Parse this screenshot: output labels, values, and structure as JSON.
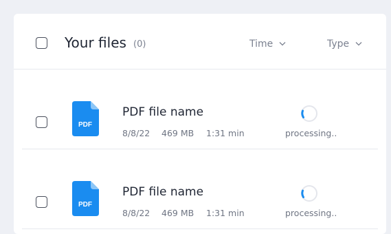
{
  "header": {
    "title": "Your files",
    "count": "(0)",
    "sort_time": "Time",
    "sort_type": "Type",
    "chevron": "⌄"
  },
  "files": [
    {
      "icon": "pdf-icon",
      "icon_label": "PDF",
      "name": "PDF file name",
      "date": "8/8/22",
      "size": "469 MB",
      "duration": "1:31 min",
      "status": "processing.."
    },
    {
      "icon": "pdf-icon",
      "icon_label": "PDF",
      "name": "PDF file name",
      "date": "8/8/22",
      "size": "469 MB",
      "duration": "1:31 min",
      "status": "processing.."
    }
  ],
  "colors": {
    "background": "#eef0f5",
    "panel": "#ffffff",
    "pdf_blue": "#1a8cf0",
    "pdf_fold": "#8cc6f7",
    "spinner_track": "#e4e6ec",
    "spinner_accent": "#1a8cf0",
    "divider": "#e6e8ee"
  }
}
